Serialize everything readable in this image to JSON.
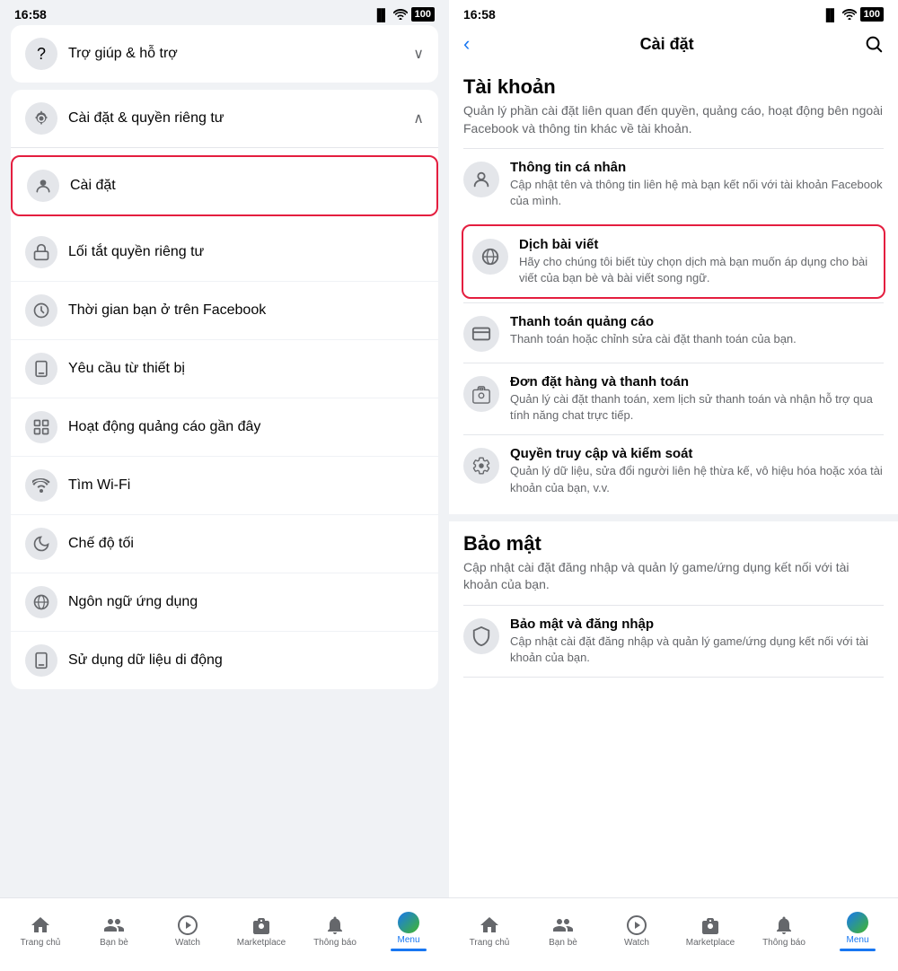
{
  "left": {
    "status": {
      "time": "16:58",
      "signal": "📶",
      "wifi": "🛜",
      "battery": "100"
    },
    "helpSection": {
      "icon": "?",
      "label": "Trợ giúp & hỗ trợ",
      "chevron": "∨"
    },
    "settingsSection": {
      "icon": "⚙",
      "label": "Cài đặt & quyền riêng tư",
      "chevron": "∧"
    },
    "menuItems": [
      {
        "icon": "👤",
        "label": "Cài đặt",
        "highlighted": true
      },
      {
        "icon": "🔒",
        "label": "Lối tắt quyền riêng tư"
      },
      {
        "icon": "⏰",
        "label": "Thời gian bạn ở trên Facebook"
      },
      {
        "icon": "📱",
        "label": "Yêu cầu từ thiết bị"
      },
      {
        "icon": "📊",
        "label": "Hoạt động quảng cáo gần đây"
      },
      {
        "icon": "📶",
        "label": "Tìm Wi-Fi"
      },
      {
        "icon": "🌙",
        "label": "Chế độ tối"
      },
      {
        "icon": "🌐",
        "label": "Ngôn ngữ ứng dụng"
      },
      {
        "icon": "📱",
        "label": "Sử dụng dữ liệu di động"
      }
    ],
    "bottomNav": [
      {
        "icon": "🏠",
        "label": "Trang chủ",
        "active": false
      },
      {
        "icon": "👥",
        "label": "Bạn bè",
        "active": false
      },
      {
        "icon": "▶",
        "label": "Watch",
        "active": false
      },
      {
        "icon": "🏪",
        "label": "Marketplace",
        "active": false
      },
      {
        "icon": "🔔",
        "label": "Thông báo",
        "active": false
      },
      {
        "icon": "☰",
        "label": "Menu",
        "active": true
      }
    ]
  },
  "right": {
    "status": {
      "time": "16:58",
      "signal": "📶",
      "wifi": "🛜",
      "battery": "100"
    },
    "header": {
      "back": "‹",
      "title": "Cài đặt",
      "search": "🔍"
    },
    "sections": [
      {
        "title": "Tài khoản",
        "desc": "Quản lý phần cài đặt liên quan đến quyền, quảng cáo, hoạt động bên ngoài Facebook và thông tin khác về tài khoản.",
        "items": [
          {
            "icon": "👤",
            "title": "Thông tin cá nhân",
            "desc": "Cập nhật tên và thông tin liên hệ mà bạn kết nối với tài khoản Facebook của mình.",
            "highlighted": false
          },
          {
            "icon": "🌐",
            "title": "Dịch bài viết",
            "desc": "Hãy cho chúng tôi biết tùy chọn dịch mà bạn muốn áp dụng cho bài viết của bạn bè và bài viết song ngữ.",
            "highlighted": true
          },
          {
            "icon": "💳",
            "title": "Thanh toán quảng cáo",
            "desc": "Thanh toán hoặc chỉnh sửa cài đặt thanh toán của bạn.",
            "highlighted": false
          },
          {
            "icon": "📦",
            "title": "Đơn đặt hàng và thanh toán",
            "desc": "Quản lý cài đặt thanh toán, xem lịch sử thanh toán và nhận hỗ trợ qua tính năng chat trực tiếp.",
            "highlighted": false
          },
          {
            "icon": "⚙",
            "title": "Quyền truy cập và kiểm soát",
            "desc": "Quản lý dữ liệu, sửa đổi người liên hệ thừa kế, vô hiệu hóa hoặc xóa tài khoản của bạn, v.v.",
            "highlighted": false
          }
        ]
      },
      {
        "title": "Bảo mật",
        "desc": "Cập nhật cài đặt đăng nhập và quản lý game/ứng dụng kết nối với tài khoản của bạn.",
        "items": [
          {
            "icon": "🛡",
            "title": "Bảo mật và đăng nhập",
            "desc": "Cập nhật cài đặt đăng nhập và quản lý game/ứng dụng kết nối với tài khoản của bạn.",
            "highlighted": false
          }
        ]
      }
    ],
    "bottomNav": [
      {
        "icon": "🏠",
        "label": "Trang chủ",
        "active": false
      },
      {
        "icon": "👥",
        "label": "Bạn bè",
        "active": false
      },
      {
        "icon": "▶",
        "label": "Watch",
        "active": false
      },
      {
        "icon": "🏪",
        "label": "Marketplace",
        "active": false
      },
      {
        "icon": "🔔",
        "label": "Thông báo",
        "active": false
      },
      {
        "icon": "☰",
        "label": "Menu",
        "active": true
      }
    ]
  }
}
